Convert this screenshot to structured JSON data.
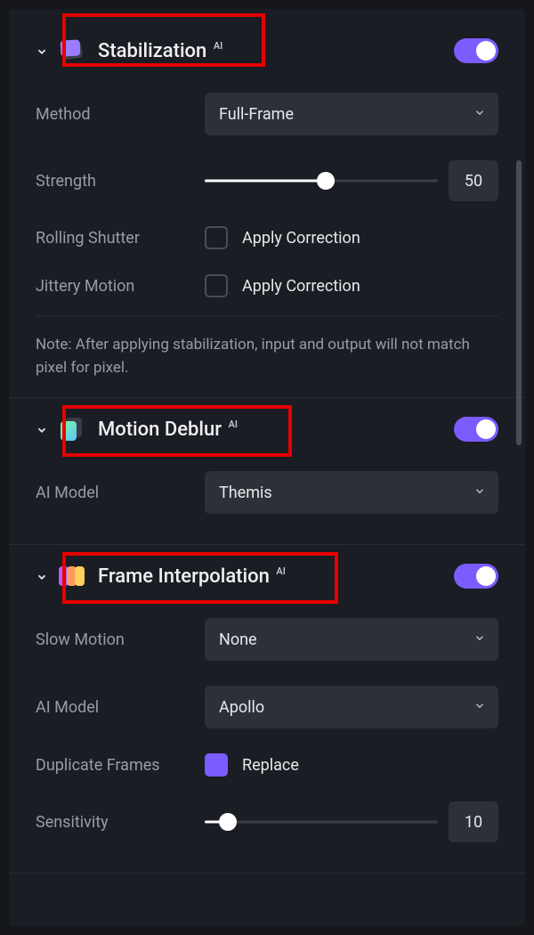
{
  "colors": {
    "accent": "#7b5cff",
    "highlight": "#e60000"
  },
  "sections": {
    "stabilization": {
      "title": "Stabilization",
      "ai_badge": "AI",
      "enabled": true,
      "method": {
        "label": "Method",
        "value": "Full-Frame"
      },
      "strength": {
        "label": "Strength",
        "value": 50,
        "percent": 52
      },
      "rolling_shutter": {
        "label": "Rolling Shutter",
        "checkbox_label": "Apply Correction",
        "checked": false
      },
      "jittery_motion": {
        "label": "Jittery Motion",
        "checkbox_label": "Apply Correction",
        "checked": false
      },
      "note": "Note: After applying stabilization, input and output will not match pixel for pixel."
    },
    "motion_deblur": {
      "title": "Motion Deblur",
      "ai_badge": "AI",
      "enabled": true,
      "ai_model": {
        "label": "AI Model",
        "value": "Themis"
      }
    },
    "frame_interpolation": {
      "title": "Frame Interpolation",
      "ai_badge": "AI",
      "enabled": true,
      "slow_motion": {
        "label": "Slow Motion",
        "value": "None"
      },
      "ai_model": {
        "label": "AI Model",
        "value": "Apollo"
      },
      "duplicate_frames": {
        "label": "Duplicate Frames",
        "checkbox_label": "Replace",
        "checked": true
      },
      "sensitivity": {
        "label": "Sensitivity",
        "value": 10,
        "percent": 10
      }
    }
  }
}
